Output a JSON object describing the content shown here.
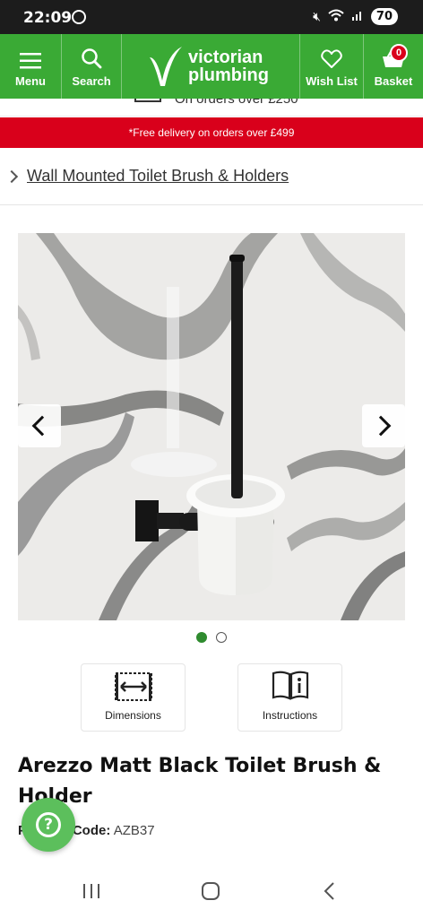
{
  "status_bar": {
    "time": "22:09",
    "battery": "70"
  },
  "header": {
    "menu_label": "Menu",
    "search_label": "Search",
    "brand_line1": "victorian",
    "brand_line2": "plumbing",
    "wishlist_label": "Wish List",
    "basket_label": "Basket",
    "basket_count": "0",
    "background_color": "#3aaa35"
  },
  "promo_peek": {
    "text": "On orders over £250"
  },
  "delivery_banner": {
    "text": "*Free delivery on orders over £499",
    "background_color": "#d9001b"
  },
  "breadcrumb": {
    "label": "Wall Mounted Toilet Brush & Holders"
  },
  "carousel": {
    "total_slides": 2,
    "active_slide": 1
  },
  "features": [
    {
      "label": "Dimensions",
      "icon": "dimensions-icon"
    },
    {
      "label": "Instructions",
      "icon": "instructions-book-icon"
    }
  ],
  "product": {
    "title": "Arezzo Matt Black Toilet Brush & Holder",
    "code_label": "Product Code:",
    "code_value": "AZB37"
  },
  "help": {
    "icon": "question-icon"
  }
}
